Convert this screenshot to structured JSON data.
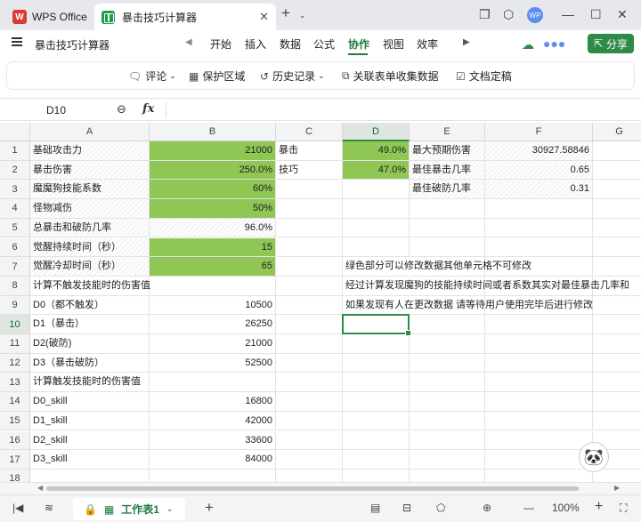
{
  "titlebar": {
    "app_tab": "WPS Office",
    "doc_tab": "暴击技巧计算器",
    "avatar_initials": "WP"
  },
  "menubar": {
    "doc_title": "暴击技巧计算器",
    "items": [
      "开始",
      "插入",
      "数据",
      "公式",
      "协作",
      "视图",
      "效率"
    ],
    "active": "协作",
    "share": "分享"
  },
  "toolbar": {
    "comment": "评论",
    "protect": "保护区域",
    "history": "历史记录",
    "collect": "关联表单收集数据",
    "finalize": "文档定稿"
  },
  "formula_bar": {
    "cell_ref": "D10",
    "fx": "fx",
    "value": ""
  },
  "columns": [
    "A",
    "B",
    "C",
    "D",
    "E",
    "F",
    "G"
  ],
  "selected_column": "D",
  "selected_row": "10",
  "rows": [
    {
      "n": "1",
      "A": "基础攻击力",
      "B": "21000",
      "C": "暴击",
      "D": "49.0%",
      "E": "最大预期伤害",
      "F": "30927.58846"
    },
    {
      "n": "2",
      "A": "暴击伤害",
      "B": "250.0%",
      "C": "技巧",
      "D": "47.0%",
      "E": "最佳暴击几率",
      "F": "0.65"
    },
    {
      "n": "3",
      "A": "魔魔狗技能系数",
      "B": "60%",
      "C": "",
      "D": "",
      "E": "最佳破防几率",
      "F": "0.31"
    },
    {
      "n": "4",
      "A": "怪物减伤",
      "B": "50%",
      "C": "",
      "D": "",
      "E": "",
      "F": ""
    },
    {
      "n": "5",
      "A": "总暴击和破防几率",
      "B": "96.0%",
      "C": "",
      "D": "",
      "E": "",
      "F": ""
    },
    {
      "n": "6",
      "A": "觉醒持续时间（秒）",
      "B": "15",
      "C": "",
      "D": "",
      "E": "",
      "F": ""
    },
    {
      "n": "7",
      "A": "觉醒冷却时间（秒）",
      "B": "65",
      "C": "",
      "D": "绿色部分可以修改数据其他单元格不可修改",
      "E": "",
      "F": ""
    },
    {
      "n": "8",
      "A": "计算不触发技能时的伤害值",
      "B": "",
      "C": "",
      "D": "经过计算发现魔狗的技能持续时间或者系数其实对最佳暴击几率和",
      "E": "",
      "F": ""
    },
    {
      "n": "9",
      "A": "D0（都不触发）",
      "B": "10500",
      "C": "",
      "D": "如果发现有人在更改数据 请等待用户使用完毕后进行修改",
      "E": "",
      "F": ""
    },
    {
      "n": "10",
      "A": "D1（暴击）",
      "B": "26250",
      "C": "",
      "D": "",
      "E": "",
      "F": ""
    },
    {
      "n": "11",
      "A": "D2(破防)",
      "B": "21000",
      "C": "",
      "D": "",
      "E": "",
      "F": ""
    },
    {
      "n": "12",
      "A": "D3（暴击破防）",
      "B": "52500",
      "C": "",
      "D": "",
      "E": "",
      "F": ""
    },
    {
      "n": "13",
      "A": "计算触发技能时的伤害值",
      "B": "",
      "C": "",
      "D": "",
      "E": "",
      "F": ""
    },
    {
      "n": "14",
      "A": "D0_skill",
      "B": "16800",
      "C": "",
      "D": "",
      "E": "",
      "F": ""
    },
    {
      "n": "15",
      "A": "D1_skill",
      "B": "42000",
      "C": "",
      "D": "",
      "E": "",
      "F": ""
    },
    {
      "n": "16",
      "A": "D2_skill",
      "B": "33600",
      "C": "",
      "D": "",
      "E": "",
      "F": ""
    },
    {
      "n": "17",
      "A": "D3_skill",
      "B": "84000",
      "C": "",
      "D": "",
      "E": "",
      "F": ""
    },
    {
      "n": "18",
      "A": "",
      "B": "",
      "C": "",
      "D": "",
      "E": "",
      "F": ""
    }
  ],
  "statusbar": {
    "sheet_name": "工作表1",
    "zoom": "100%"
  },
  "colors": {
    "accent": "#2e8b47",
    "editable_fill": "#8fc654"
  }
}
